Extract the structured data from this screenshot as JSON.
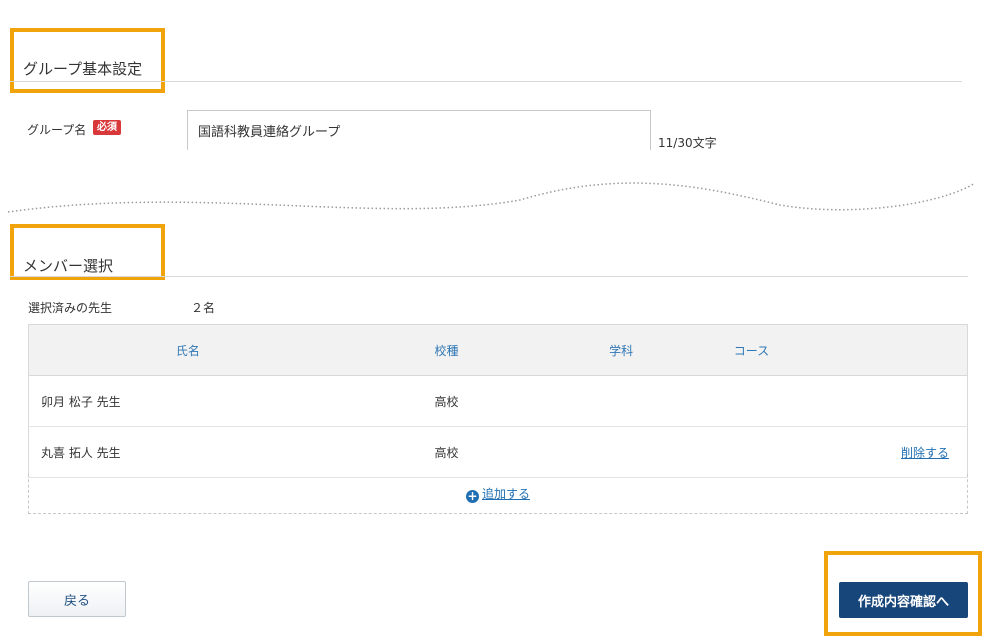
{
  "basic_settings": {
    "title": "グループ基本設定",
    "group_name_label": "グループ名",
    "required_badge": "必須",
    "group_name_value": "国語科教員連絡グループ",
    "char_count": "11/30文字"
  },
  "member_selection": {
    "title": "メンバー選択",
    "selected_label": "選択済みの先生",
    "selected_count": "２名",
    "table": {
      "headers": [
        "氏名",
        "校種",
        "学科",
        "コース"
      ],
      "rows": [
        {
          "name": "卯月 松子 先生",
          "school_type": "高校",
          "department": "",
          "course": "",
          "action": ""
        },
        {
          "name": "丸喜 拓人 先生",
          "school_type": "高校",
          "department": "",
          "course": "",
          "action": "削除する"
        }
      ]
    },
    "add_label": "追加する"
  },
  "footer": {
    "back_label": "戻る",
    "confirm_label": "作成内容確認へ"
  },
  "colors": {
    "highlight": "#f0a30a",
    "link": "#1f6fb2",
    "primary_button": "#17467a",
    "required_badge": "#d9383a"
  },
  "icons": {
    "add": "plus-circle-icon"
  }
}
